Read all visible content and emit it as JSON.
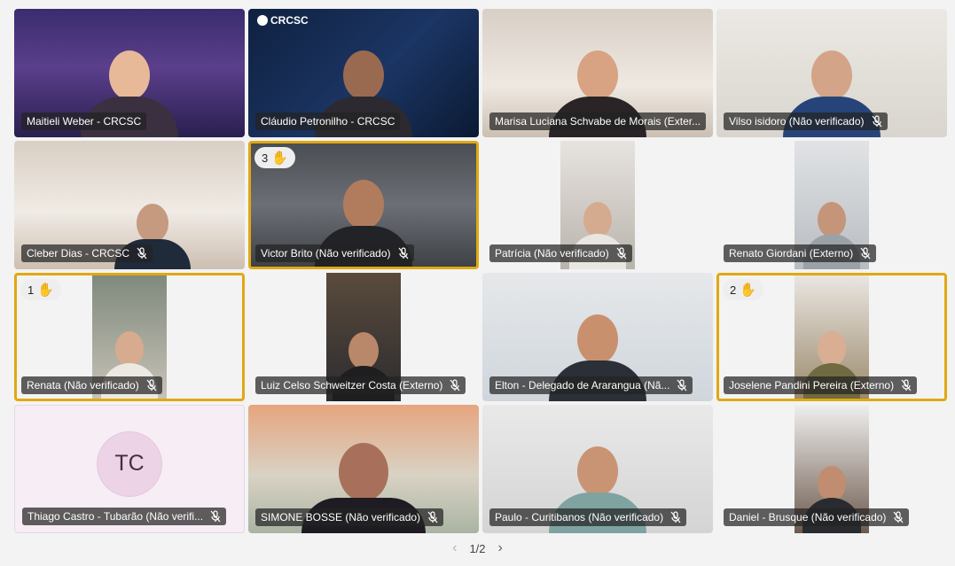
{
  "participants": [
    {
      "name": "Maitieli Weber - CRCSC",
      "muted": false,
      "hand": ""
    },
    {
      "name": "Cláudio Petronilho - CRCSC",
      "muted": false,
      "hand": "",
      "logo": "CRCSC"
    },
    {
      "name": "Marisa Luciana Schvabe de Morais (Exter...",
      "muted": false,
      "hand": ""
    },
    {
      "name": "Vilso isidoro (Não verificado)",
      "muted": true,
      "hand": ""
    },
    {
      "name": "Cleber Dias - CRCSC",
      "muted": true,
      "hand": ""
    },
    {
      "name": "Victor Brito (Não verificado)",
      "muted": true,
      "hand": "3"
    },
    {
      "name": "Patrícia (Não verificado)",
      "muted": true,
      "hand": ""
    },
    {
      "name": "Renato Giordani (Externo)",
      "muted": true,
      "hand": ""
    },
    {
      "name": "Renata (Não verificado)",
      "muted": true,
      "hand": "1"
    },
    {
      "name": "Luiz Celso Schweitzer Costa (Externo)",
      "muted": true,
      "hand": ""
    },
    {
      "name": "Joselene Pandini Pereira (Externo)",
      "muted": true,
      "hand": "2"
    },
    {
      "name": "Elton - Delegado de Ararangua (Nã...",
      "muted": true,
      "hand": ""
    },
    {
      "name": "Thiago Castro - Tubarão (Não verifi...",
      "muted": true,
      "hand": "",
      "initials": "TC"
    },
    {
      "name": "SIMONE BOSSE (Não verificado)",
      "muted": true,
      "hand": ""
    },
    {
      "name": "Paulo - Curitibanos (Não verificado)",
      "muted": true,
      "hand": ""
    },
    {
      "name": "Daniel - Brusque (Não verificado)",
      "muted": true,
      "hand": ""
    }
  ],
  "hand_icon": "raised-hand-icon",
  "mic_icon": "mic-off-icon",
  "accent_color": "#e0a812",
  "pager": {
    "label": "1/2",
    "prev_icon": "chevron-left-icon",
    "next_icon": "chevron-right-icon"
  }
}
